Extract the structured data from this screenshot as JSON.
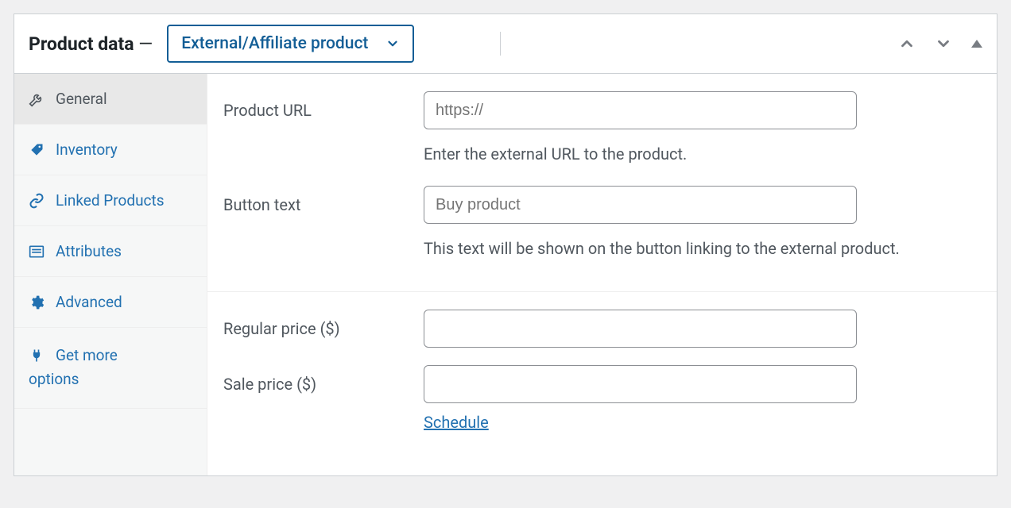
{
  "header": {
    "title_prefix": "Product data",
    "title_dash": " — ",
    "type_selected": "External/Affiliate product"
  },
  "sidebar": {
    "tabs": [
      {
        "label": "General"
      },
      {
        "label": "Inventory"
      },
      {
        "label": "Linked Products"
      },
      {
        "label": "Attributes"
      },
      {
        "label": "Advanced"
      },
      {
        "label_line1": "Get more",
        "label_line2": "options"
      }
    ]
  },
  "form": {
    "product_url": {
      "label": "Product URL",
      "placeholder": "https://",
      "value": "",
      "description": "Enter the external URL to the product."
    },
    "button_text": {
      "label": "Button text",
      "placeholder": "Buy product",
      "value": "",
      "description": "This text will be shown on the button linking to the external product."
    },
    "regular_price": {
      "label": "Regular price ($)",
      "value": ""
    },
    "sale_price": {
      "label": "Sale price ($)",
      "value": "",
      "schedule_link": "Schedule"
    }
  }
}
